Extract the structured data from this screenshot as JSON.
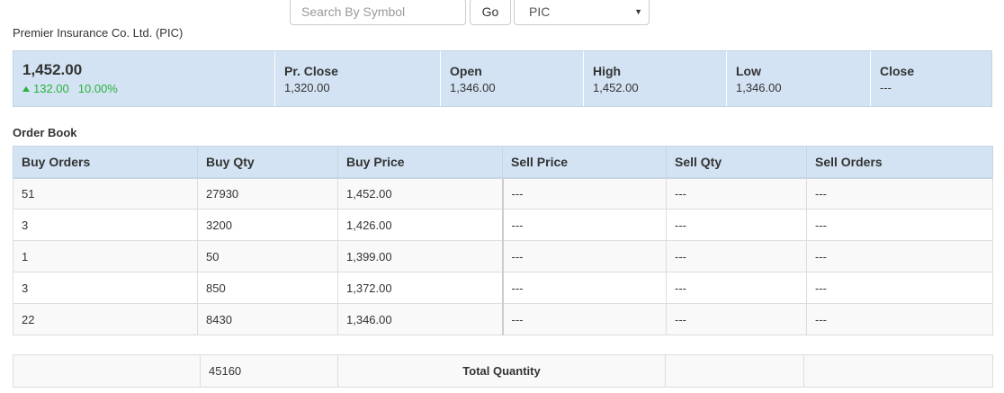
{
  "search": {
    "placeholder": "Search By Symbol",
    "value": "",
    "go_label": "Go",
    "selected_symbol": "PIC"
  },
  "company": {
    "title": "Premier Insurance Co. Ltd. (PIC)"
  },
  "quote": {
    "price": "1,452.00",
    "change": "132.00",
    "change_pct": "10.00%",
    "stats": [
      {
        "label": "Pr. Close",
        "value": "1,320.00"
      },
      {
        "label": "Open",
        "value": "1,346.00"
      },
      {
        "label": "High",
        "value": "1,452.00"
      },
      {
        "label": "Low",
        "value": "1,346.00"
      },
      {
        "label": "Close",
        "value": "---"
      }
    ]
  },
  "order_book": {
    "title": "Order Book",
    "headers": [
      "Buy Orders",
      "Buy Qty",
      "Buy Price",
      "Sell Price",
      "Sell Qty",
      "Sell Orders"
    ],
    "rows": [
      [
        "51",
        "27930",
        "1,452.00",
        "---",
        "---",
        "---"
      ],
      [
        "3",
        "3200",
        "1,426.00",
        "---",
        "---",
        "---"
      ],
      [
        "1",
        "50",
        "1,399.00",
        "---",
        "---",
        "---"
      ],
      [
        "3",
        "850",
        "1,372.00",
        "---",
        "---",
        "---"
      ],
      [
        "22",
        "8430",
        "1,346.00",
        "---",
        "---",
        "---"
      ]
    ],
    "total": {
      "buy_qty": "45160",
      "label": "Total Quantity"
    }
  },
  "colors": {
    "header_bg": "#d3e3f3",
    "positive": "#27b23b"
  }
}
